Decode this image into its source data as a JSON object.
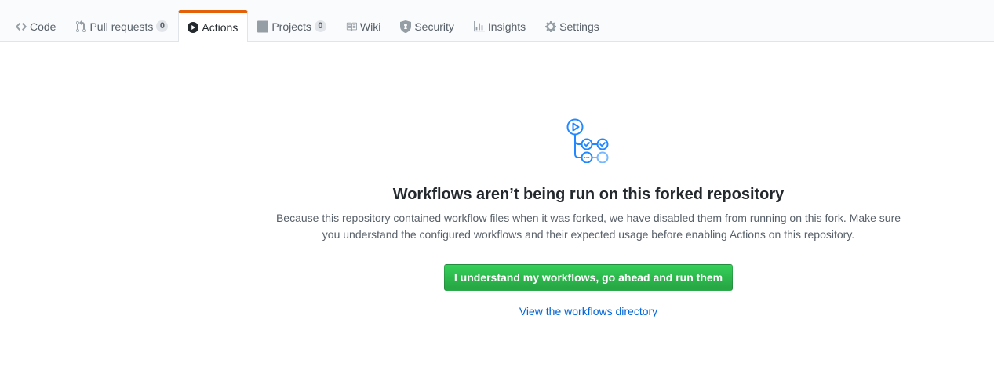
{
  "nav": {
    "tabs": [
      {
        "label": "Code",
        "icon": "code-icon"
      },
      {
        "label": "Pull requests",
        "icon": "git-pull-request-icon",
        "count": "0"
      },
      {
        "label": "Actions",
        "icon": "play-icon",
        "selected": true
      },
      {
        "label": "Projects",
        "icon": "project-icon",
        "count": "0"
      },
      {
        "label": "Wiki",
        "icon": "book-icon"
      },
      {
        "label": "Security",
        "icon": "shield-icon"
      },
      {
        "label": "Insights",
        "icon": "graph-icon"
      },
      {
        "label": "Settings",
        "icon": "gear-icon"
      }
    ],
    "accent": "#e36209"
  },
  "blankslate": {
    "icon": "workflow-icon",
    "title": "Workflows aren’t being run on this forked repository",
    "description": "Because this repository contained workflow files when it was forked, we have disabled them from running on this fork. Make sure you understand the configured workflows and their expected usage before enabling Actions on this repository.",
    "primary_button": "I understand my workflows, go ahead and run them",
    "link": "View the workflows directory"
  },
  "colors": {
    "button_green": "#28a745",
    "link_blue": "#0366d6",
    "workflow_blue": "#2188ff"
  }
}
